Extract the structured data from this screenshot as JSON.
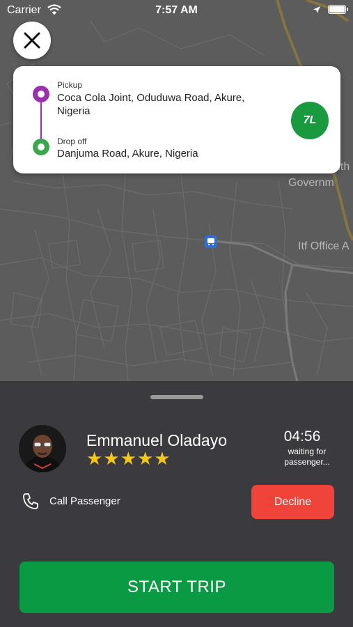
{
  "status_bar": {
    "carrier": "Carrier",
    "time": "7:57 AM"
  },
  "map": {
    "labels": [
      "uth",
      "Governm",
      "Itf Office A"
    ]
  },
  "trip": {
    "pickup_label": "Pickup",
    "pickup_address": "Coca Cola Joint, Oduduwa Road, Akure, Nigeria",
    "dropoff_label": "Drop off",
    "dropoff_address": "Danjuma Road, Akure, Nigeria",
    "badge_text": "7L"
  },
  "passenger": {
    "name": "Emmanuel Oladayo",
    "rating": 5,
    "stars": "★★★★★",
    "countdown": "04:56",
    "waiting_text": "waiting for passenger..."
  },
  "actions": {
    "call_label": "Call Passenger",
    "decline_label": "Decline",
    "start_label": "START TRIP"
  },
  "colors": {
    "map_bg": "#5b5b5b",
    "pickup_pin": "#9b2fb0",
    "dropoff_pin": "#3aa84a",
    "decline": "#f0433a",
    "start_trip": "#0a9a43",
    "star": "#f5c518",
    "sheet_bg": "#3a3a3f"
  }
}
